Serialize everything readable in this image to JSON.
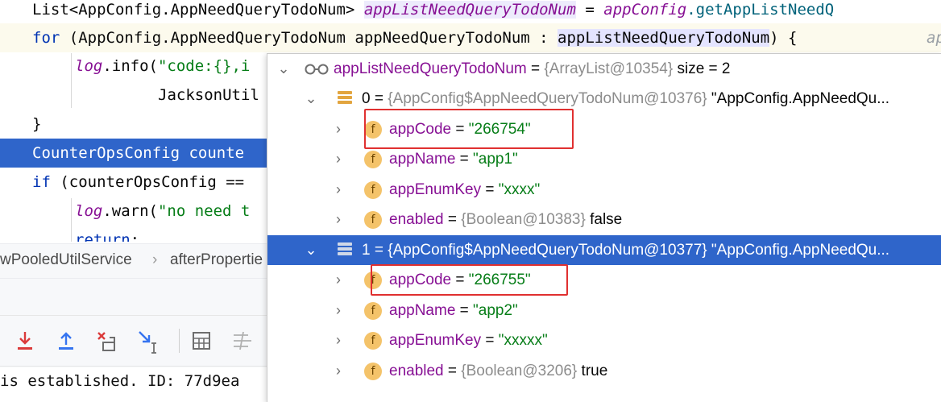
{
  "editor": {
    "lines": [
      {
        "parts": [
          "List<AppConfig.AppNeedQueryTodoNum> ",
          "appListNeedQueryTodoNum",
          " = ",
          "appConfig",
          ".getAppListNeedQ"
        ]
      },
      {
        "parts": [
          "for",
          " (AppConfig.AppNeedQueryTodoNum appNeedQueryTodoNum : ",
          "appListNeedQueryTodoNum",
          ") {",
          "ap"
        ]
      },
      {
        "parts": [
          "log",
          ".info(",
          "\"code:{},i"
        ]
      },
      {
        "parts": [
          "JacksonUtil"
        ]
      },
      {
        "parts": [
          "}"
        ]
      },
      {
        "parts": [
          "CounterOpsConfig counte"
        ]
      },
      {
        "parts": [
          "if",
          " (counterOpsConfig =="
        ]
      },
      {
        "parts": [
          "log",
          ".warn(",
          "\"no need t"
        ]
      },
      {
        "parts": [
          "return",
          ";"
        ]
      }
    ]
  },
  "breadcrumb": {
    "items": [
      "wPooledUtilService",
      "afterPropertie"
    ]
  },
  "console": {
    "text": "is established. ID: 77d9ea"
  },
  "popup": {
    "root": {
      "name": "appListNeedQueryTodoNum",
      "eq": " = ",
      "type": "{ArrayList@10354}",
      "extra": "  size = 2"
    },
    "items": [
      {
        "index": "0 = ",
        "type": "{AppConfig$AppNeedQueryTodoNum@10376}",
        "preview": " \"AppConfig.AppNeedQu...",
        "fields": [
          {
            "name": "appCode",
            "eq": " = ",
            "value": "\"266754\""
          },
          {
            "name": "appName",
            "eq": " = ",
            "value": "\"app1\""
          },
          {
            "name": "appEnumKey",
            "eq": " = ",
            "value": "\"xxxx\""
          },
          {
            "name": "enabled",
            "eq": " = ",
            "type": "{Boolean@10383}",
            "value": " false"
          }
        ]
      },
      {
        "index": "1 = ",
        "type": "{AppConfig$AppNeedQueryTodoNum@10377}",
        "preview": " \"AppConfig.AppNeedQu...",
        "fields": [
          {
            "name": "appCode",
            "eq": " = ",
            "value": "\"266755\""
          },
          {
            "name": "appName",
            "eq": " = ",
            "value": "\"app2\""
          },
          {
            "name": "appEnumKey",
            "eq": " = ",
            "value": "\"xxxxx\""
          },
          {
            "name": "enabled",
            "eq": " = ",
            "type": "{Boolean@3206}",
            "value": " true"
          }
        ]
      }
    ],
    "field_icon_letter": "f"
  },
  "icons": {
    "watch": "glasses-icon",
    "array": "array-icon",
    "field": "field-icon",
    "toolbar": [
      "step-into-red-icon",
      "step-out-icon",
      "drop-frame-icon",
      "run-to-cursor-icon",
      "evaluate-table-icon",
      "stream-trace-icon"
    ]
  },
  "colors": {
    "selection": "#2f65ca",
    "highlight_box": "#e03030",
    "field_icon": "#f4c36a",
    "string": "#067d17",
    "field_name": "#871094"
  }
}
